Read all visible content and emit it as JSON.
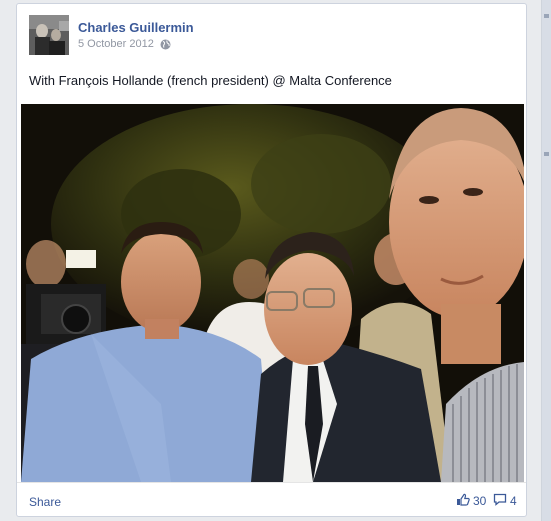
{
  "post": {
    "author": "Charles Guillermin",
    "date": "5 October 2012",
    "privacy_icon": "globe-icon",
    "text": "With François Hollande (french president) @ Malta Conference"
  },
  "footer": {
    "share_label": "Share",
    "like_icon": "thumbs-up-icon",
    "like_count": "30",
    "comment_icon": "comment-icon",
    "comment_count": "4"
  },
  "colors": {
    "link": "#3b5998",
    "meta": "#9197a3",
    "background": "#e9ebee"
  }
}
